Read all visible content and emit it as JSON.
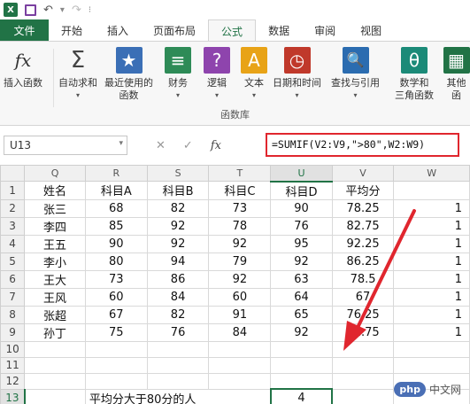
{
  "qat": {
    "app_icon": "X",
    "undo_icon": "undo-icon",
    "redo_icon": "redo-icon",
    "separator": "⁝"
  },
  "tabs": [
    {
      "label": "文件",
      "active": false
    },
    {
      "label": "开始",
      "active": false
    },
    {
      "label": "插入",
      "active": false
    },
    {
      "label": "页面布局",
      "active": false
    },
    {
      "label": "公式",
      "active": true
    },
    {
      "label": "数据",
      "active": false
    },
    {
      "label": "审阅",
      "active": false
    },
    {
      "label": "视图",
      "active": false
    }
  ],
  "ribbon": {
    "buttons": [
      {
        "label1": "插入函数",
        "label2": "",
        "icon": "fx-icon",
        "color": "#ffffff"
      },
      {
        "label1": "自动求和",
        "label2": "",
        "icon": "sigma-icon",
        "color": "#ffffff"
      },
      {
        "label1": "最近使用的",
        "label2": "函数",
        "icon": "star-icon",
        "color": "#3b6fb6"
      },
      {
        "label1": "财务",
        "label2": "",
        "icon": "coins-icon",
        "color": "#2e8b57"
      },
      {
        "label1": "逻辑",
        "label2": "",
        "icon": "question-icon",
        "color": "#8e44ad"
      },
      {
        "label1": "文本",
        "label2": "",
        "icon": "text-icon",
        "color": "#e8a317"
      },
      {
        "label1": "日期和时间",
        "label2": "",
        "icon": "clock-icon",
        "color": "#c0392b"
      },
      {
        "label1": "查找与引用",
        "label2": "",
        "icon": "lookup-icon",
        "color": "#2b6cb0"
      },
      {
        "label1": "数学和",
        "label2": "三角函数",
        "icon": "theta-icon",
        "color": "#1b8a78"
      },
      {
        "label1": "其他函",
        "label2": "",
        "icon": "more-icon",
        "color": "#217346"
      }
    ],
    "group_label": "函数库",
    "symbols": {
      "fx": "fx",
      "sigma": "Σ",
      "star": "★",
      "coins": "≡",
      "question": "?",
      "text": "A",
      "clock": "◷",
      "lookup": "🔍",
      "theta": "θ",
      "more": "▦"
    }
  },
  "formula_bar": {
    "name_box": "U13",
    "cancel_symbol": "✕",
    "enter_symbol": "✓",
    "fx_symbol": "fx",
    "formula": "=SUMIF(V2:V9,\">80\",W2:W9)"
  },
  "sheet": {
    "columns": [
      "Q",
      "R",
      "S",
      "T",
      "U",
      "V",
      "W"
    ],
    "selected_column": "U",
    "rows": [
      {
        "n": "1",
        "cells": [
          "姓名",
          "科目A",
          "科目B",
          "科目C",
          "科目D",
          "平均分",
          ""
        ]
      },
      {
        "n": "2",
        "cells": [
          "张三",
          "68",
          "82",
          "73",
          "90",
          "78.25",
          "1"
        ]
      },
      {
        "n": "3",
        "cells": [
          "李四",
          "85",
          "92",
          "78",
          "76",
          "82.75",
          "1"
        ]
      },
      {
        "n": "4",
        "cells": [
          "王五",
          "90",
          "92",
          "92",
          "95",
          "92.25",
          "1"
        ]
      },
      {
        "n": "5",
        "cells": [
          "李小",
          "80",
          "94",
          "79",
          "92",
          "86.25",
          "1"
        ]
      },
      {
        "n": "6",
        "cells": [
          "王大",
          "73",
          "86",
          "92",
          "63",
          "78.5",
          "1"
        ]
      },
      {
        "n": "7",
        "cells": [
          "王风",
          "60",
          "84",
          "60",
          "64",
          "67",
          "1"
        ]
      },
      {
        "n": "8",
        "cells": [
          "张超",
          "67",
          "82",
          "91",
          "65",
          "76.25",
          "1"
        ]
      },
      {
        "n": "9",
        "cells": [
          "孙丁",
          "75",
          "76",
          "84",
          "92",
          "81.75",
          "1"
        ]
      },
      {
        "n": "10",
        "cells": [
          "",
          "",
          "",
          "",
          "",
          "",
          ""
        ]
      },
      {
        "n": "11",
        "cells": [
          "",
          "",
          "",
          "",
          "",
          "",
          ""
        ]
      },
      {
        "n": "12",
        "cells": [
          "",
          "",
          "",
          "",
          "",
          "",
          ""
        ]
      },
      {
        "n": "13",
        "cells": [
          "",
          "平均分大于80分的人",
          "",
          "",
          "4",
          "",
          ""
        ]
      }
    ],
    "selected_row": "13"
  },
  "watermark": {
    "badge": "php",
    "text": "中文网"
  },
  "colors": {
    "accent": "#217346",
    "highlight_red": "#e0262e"
  }
}
